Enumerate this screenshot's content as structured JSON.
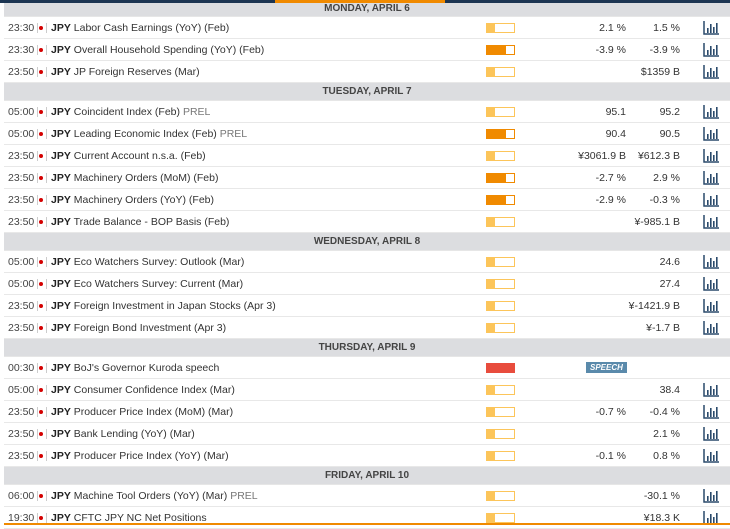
{
  "colors": {
    "high": "#e84c3d",
    "medium": "#f08a00",
    "low": "#fcc55a",
    "speech": "#5a8aab"
  },
  "days": [
    {
      "label": "MONDAY, APRIL 6",
      "events": [
        {
          "time": "23:30",
          "currency": "JPY",
          "name": "Labor Cash Earnings (YoY) (Feb)",
          "prel": "",
          "impact": "low",
          "actual": "2.1 %",
          "forecast": "1.5 %"
        },
        {
          "time": "23:30",
          "currency": "JPY",
          "name": "Overall Household Spending (YoY) (Feb)",
          "prel": "",
          "impact": "medium",
          "actual": "-3.9 %",
          "forecast": "-3.9 %"
        },
        {
          "time": "23:50",
          "currency": "JPY",
          "name": "JP Foreign Reserves (Mar)",
          "prel": "",
          "impact": "low",
          "actual": "",
          "forecast": "$1359 B"
        }
      ]
    },
    {
      "label": "TUESDAY, APRIL 7",
      "events": [
        {
          "time": "05:00",
          "currency": "JPY",
          "name": "Coincident Index (Feb)",
          "prel": "PREL",
          "impact": "low",
          "actual": "95.1",
          "forecast": "95.2"
        },
        {
          "time": "05:00",
          "currency": "JPY",
          "name": "Leading Economic Index (Feb)",
          "prel": "PREL",
          "impact": "medium",
          "actual": "90.4",
          "forecast": "90.5"
        },
        {
          "time": "23:50",
          "currency": "JPY",
          "name": "Current Account n.s.a. (Feb)",
          "prel": "",
          "impact": "low",
          "actual": "¥3061.9 B",
          "forecast": "¥612.3 B"
        },
        {
          "time": "23:50",
          "currency": "JPY",
          "name": "Machinery Orders (MoM) (Feb)",
          "prel": "",
          "impact": "medium",
          "actual": "-2.7 %",
          "forecast": "2.9 %"
        },
        {
          "time": "23:50",
          "currency": "JPY",
          "name": "Machinery Orders (YoY) (Feb)",
          "prel": "",
          "impact": "medium",
          "actual": "-2.9 %",
          "forecast": "-0.3 %"
        },
        {
          "time": "23:50",
          "currency": "JPY",
          "name": "Trade Balance - BOP Basis (Feb)",
          "prel": "",
          "impact": "low",
          "actual": "",
          "forecast": "¥-985.1 B"
        }
      ]
    },
    {
      "label": "WEDNESDAY, APRIL 8",
      "events": [
        {
          "time": "05:00",
          "currency": "JPY",
          "name": "Eco Watchers Survey: Outlook (Mar)",
          "prel": "",
          "impact": "low",
          "actual": "",
          "forecast": "24.6"
        },
        {
          "time": "05:00",
          "currency": "JPY",
          "name": "Eco Watchers Survey: Current (Mar)",
          "prel": "",
          "impact": "low",
          "actual": "",
          "forecast": "27.4"
        },
        {
          "time": "23:50",
          "currency": "JPY",
          "name": "Foreign Investment in Japan Stocks (Apr 3)",
          "prel": "",
          "impact": "low",
          "actual": "",
          "forecast": "¥-1421.9 B"
        },
        {
          "time": "23:50",
          "currency": "JPY",
          "name": "Foreign Bond Investment (Apr 3)",
          "prel": "",
          "impact": "low",
          "actual": "",
          "forecast": "¥-1.7 B"
        }
      ]
    },
    {
      "label": "THURSDAY, APRIL 9",
      "events": [
        {
          "time": "00:30",
          "currency": "JPY",
          "name": "BoJ's Governor Kuroda speech",
          "prel": "",
          "impact": "high",
          "actual": "",
          "forecast": "",
          "speech": "SPEECH"
        },
        {
          "time": "05:00",
          "currency": "JPY",
          "name": "Consumer Confidence Index (Mar)",
          "prel": "",
          "impact": "low",
          "actual": "",
          "forecast": "38.4"
        },
        {
          "time": "23:50",
          "currency": "JPY",
          "name": "Producer Price Index (MoM) (Mar)",
          "prel": "",
          "impact": "low",
          "actual": "-0.7 %",
          "forecast": "-0.4 %"
        },
        {
          "time": "23:50",
          "currency": "JPY",
          "name": "Bank Lending (YoY) (Mar)",
          "prel": "",
          "impact": "low",
          "actual": "",
          "forecast": "2.1 %"
        },
        {
          "time": "23:50",
          "currency": "JPY",
          "name": "Producer Price Index (YoY) (Mar)",
          "prel": "",
          "impact": "low",
          "actual": "-0.1 %",
          "forecast": "0.8 %"
        }
      ]
    },
    {
      "label": "FRIDAY, APRIL 10",
      "events": [
        {
          "time": "06:00",
          "currency": "JPY",
          "name": "Machine Tool Orders (YoY) (Mar)",
          "prel": "PREL",
          "impact": "low",
          "actual": "",
          "forecast": "-30.1 %"
        },
        {
          "time": "19:30",
          "currency": "JPY",
          "name": "CFTC JPY NC Net Positions",
          "prel": "",
          "impact": "low",
          "actual": "",
          "forecast": "¥18.3 K"
        }
      ]
    }
  ]
}
